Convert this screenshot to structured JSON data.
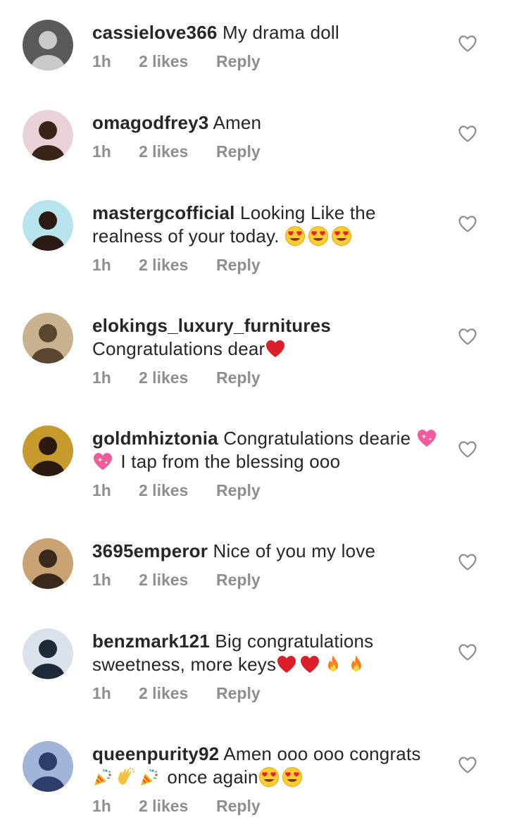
{
  "comments": [
    {
      "username": "cassielove366",
      "text_parts": [
        {
          "type": "text",
          "value": "My drama doll"
        }
      ],
      "time": "1h",
      "likes": "2 likes",
      "reply_label": "Reply",
      "avatar_colors": [
        "#5a5a5a",
        "#c9c9c9"
      ]
    },
    {
      "username": "omagodfrey3",
      "text_parts": [
        {
          "type": "text",
          "value": "Amen"
        }
      ],
      "time": "1h",
      "likes": "2 likes",
      "reply_label": "Reply",
      "avatar_colors": [
        "#e8d2d8",
        "#3a2418"
      ]
    },
    {
      "username": "mastergcofficial",
      "text_parts": [
        {
          "type": "text",
          "value": "Looking Like the realness of your today. "
        },
        {
          "type": "emoji",
          "value": "heart-eyes-emoji"
        },
        {
          "type": "emoji",
          "value": "heart-eyes-emoji"
        },
        {
          "type": "emoji",
          "value": "heart-eyes-emoji"
        }
      ],
      "time": "1h",
      "likes": "2 likes",
      "reply_label": "Reply",
      "avatar_colors": [
        "#b6e3ec",
        "#2c1a14"
      ]
    },
    {
      "username": "elokings_luxury_furnitures",
      "text_parts": [
        {
          "type": "text",
          "value": "Congratulations dear"
        },
        {
          "type": "emoji",
          "value": "red-heart-emoji"
        }
      ],
      "time": "1h",
      "likes": "2 likes",
      "reply_label": "Reply",
      "avatar_colors": [
        "#c8b18e",
        "#5b4630"
      ]
    },
    {
      "username": "goldmhiztonia",
      "text_parts": [
        {
          "type": "text",
          "value": "Congratulations dearie "
        },
        {
          "type": "emoji",
          "value": "sparkling-heart-emoji"
        },
        {
          "type": "emoji",
          "value": "sparkling-heart-emoji"
        },
        {
          "type": "text",
          "value": " I tap from the blessing ooo"
        }
      ],
      "time": "1h",
      "likes": "2 likes",
      "reply_label": "Reply",
      "avatar_colors": [
        "#c79a2e",
        "#2a1a10"
      ]
    },
    {
      "username": "3695emperor",
      "text_parts": [
        {
          "type": "text",
          "value": "Nice of you my love"
        }
      ],
      "time": "1h",
      "likes": "2 likes",
      "reply_label": "Reply",
      "avatar_colors": [
        "#c9a273",
        "#3a2a1e"
      ]
    },
    {
      "username": "benzmark121",
      "text_parts": [
        {
          "type": "text",
          "value": "Big congratulations sweetness, more keys"
        },
        {
          "type": "emoji",
          "value": "red-heart-emoji"
        },
        {
          "type": "emoji",
          "value": "red-heart-emoji"
        },
        {
          "type": "emoji",
          "value": "fire-emoji"
        },
        {
          "type": "emoji",
          "value": "fire-emoji"
        }
      ],
      "time": "1h",
      "likes": "2 likes",
      "reply_label": "Reply",
      "avatar_colors": [
        "#d9e2ea",
        "#1d2a3a"
      ]
    },
    {
      "username": "queenpurity92",
      "text_parts": [
        {
          "type": "text",
          "value": "Amen ooo ooo congrats "
        },
        {
          "type": "emoji",
          "value": "party-popper-emoji"
        },
        {
          "type": "emoji",
          "value": "clapping-hands-emoji"
        },
        {
          "type": "emoji",
          "value": "party-popper-emoji"
        },
        {
          "type": "text",
          "value": " once again"
        },
        {
          "type": "emoji",
          "value": "heart-eyes-emoji"
        },
        {
          "type": "emoji",
          "value": "heart-eyes-emoji"
        }
      ],
      "time": "1h",
      "likes": "2 likes",
      "reply_label": "Reply",
      "avatar_colors": [
        "#9fb4d6",
        "#2d3e6b"
      ]
    }
  ],
  "colors": {
    "text": "#262626",
    "meta": "#8e8e8e",
    "heart_outline": "#8e8e8e"
  }
}
